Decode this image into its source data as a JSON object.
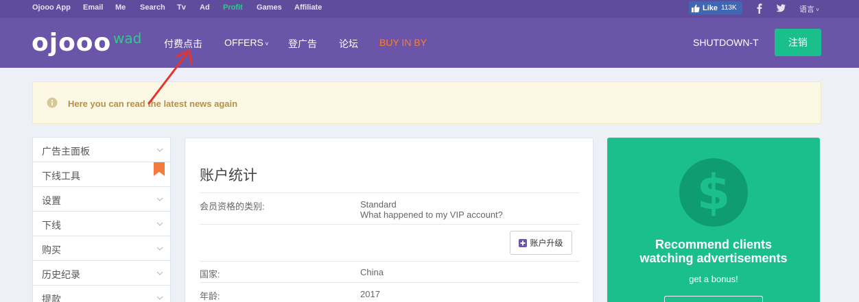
{
  "topbar": {
    "links": [
      "Ojooo App",
      "Email",
      "Me",
      "Search",
      "Tv",
      "Ad",
      "Profit",
      "Games",
      "Affiliate"
    ],
    "fb_like": "Like",
    "fb_count": "113K",
    "language": "语言"
  },
  "header": {
    "logo": "ojooo",
    "logo_sub": "wad",
    "nav": [
      "付费点击",
      "OFFERS",
      "登广告",
      "论坛",
      "BUY IN BY"
    ],
    "user": "SHUTDOWN-T",
    "logout": "注销"
  },
  "alert": {
    "message": "Here you can read the latest news again"
  },
  "sidebar": {
    "items": [
      "广告主面板",
      "下线工具",
      "设置",
      "下线",
      "购买",
      "历史纪录",
      "提款"
    ]
  },
  "account": {
    "title": "账户统计",
    "membership_label": "会员资格的类别:",
    "membership_value": "Standard",
    "vip_link": "What happened to my VIP account?",
    "upgrade_button": "账户升级",
    "country_label": "国家:",
    "country_value": "China",
    "age_label": "年龄:",
    "age_value": "2017"
  },
  "promo": {
    "headline_1": "Recommend clients",
    "headline_2": "watching advertisements",
    "subtext": "get a bonus!"
  },
  "colors": {
    "topbar": "#5f4c9c",
    "header": "#6a55a8",
    "accent_green": "#1bbf8c",
    "accent_orange": "#ff7b2c"
  }
}
